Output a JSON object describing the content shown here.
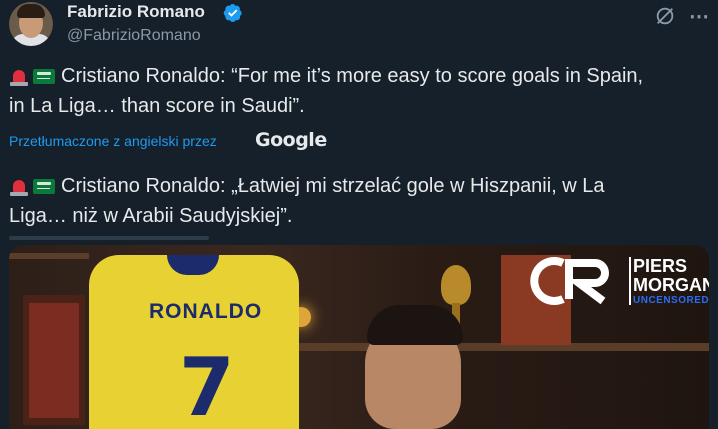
{
  "author": {
    "name": "Fabrizio Romano",
    "handle": "@FabrizioRomano",
    "verified": true
  },
  "colors": {
    "background": "#15202b",
    "link": "#1d9bf0",
    "verified": "#1d9bf0",
    "muted_text": "#8b98a5"
  },
  "tweet": {
    "original_line1": "Cristiano Ronaldo: “For me it’s more easy to score goals in Spain,",
    "original_line2": "in La Liga… than score in Saudi”.",
    "translated_label": "Przetłumaczone z angielski przez",
    "translator": "Google",
    "translation_line1": "Cristiano Ronaldo: „Łatwiej mi strzelać gole w Hiszpanii, w La",
    "translation_line2": "Liga… niż w Arabii Saudyjskiej”."
  },
  "icons": {
    "verified": "verified-badge-icon",
    "grok": "grok-icon",
    "more": "more-options-icon",
    "siren": "police-light-emoji",
    "flag": "saudi-arabia-flag-emoji"
  },
  "media": {
    "jersey_name": "RONALDO",
    "jersey_number": "7",
    "logo_title": "PIERS\nMORGAN",
    "logo_line1": "PIERS",
    "logo_line2": "MORGAN",
    "logo_subtitle": "UNCENSORED"
  }
}
